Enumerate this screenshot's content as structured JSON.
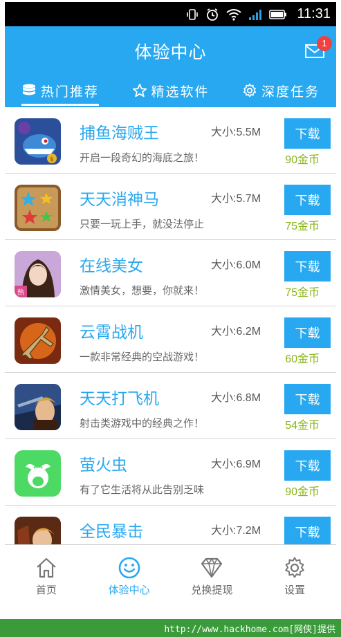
{
  "status_bar": {
    "time": "11:31"
  },
  "header": {
    "title": "体验中心",
    "badge_count": "1"
  },
  "tabs": [
    {
      "label": "热门推荐",
      "icon": "database-stack-icon",
      "active": true
    },
    {
      "label": "精选软件",
      "icon": "star-outline-icon",
      "active": false
    },
    {
      "label": "深度任务",
      "icon": "gear-icon",
      "active": false
    }
  ],
  "apps": [
    {
      "name": "捕鱼海贼王",
      "size": "大小:5.5M",
      "desc": "开启一段奇幻的海底之旅！",
      "button": "下载",
      "coins": "90金币",
      "icon": "shark-game-icon"
    },
    {
      "name": "天天消神马",
      "size": "大小:5.7M",
      "desc": "只要一玩上手，就没法停止",
      "button": "下载",
      "coins": "75金币",
      "icon": "star-match-game-icon"
    },
    {
      "name": "在线美女",
      "size": "大小:6.0M",
      "desc": "激情美女，想要，你就来！",
      "button": "下载",
      "coins": "75金币",
      "icon": "girl-portrait-icon"
    },
    {
      "name": "云霄战机",
      "size": "大小:6.2M",
      "desc": "一款非常经典的空战游戏！",
      "button": "下载",
      "coins": "60金币",
      "icon": "fighter-jet-icon"
    },
    {
      "name": "天天打飞机",
      "size": "大小:6.8M",
      "desc": "射击类游戏中的经典之作！",
      "button": "下载",
      "coins": "54金币",
      "icon": "warrior-game-icon"
    },
    {
      "name": "萤火虫",
      "size": "大小:6.9M",
      "desc": "有了它生活将从此告别乏味",
      "button": "下载",
      "coins": "90金币",
      "icon": "firefly-icon"
    },
    {
      "name": "全民暴击",
      "size": "大小:7.2M",
      "desc": "",
      "button": "下载",
      "coins": "",
      "icon": "fighter-character-icon"
    }
  ],
  "bottom_nav": [
    {
      "label": "首页",
      "icon": "home-icon",
      "active": false
    },
    {
      "label": "体验中心",
      "icon": "smiley-icon",
      "active": true
    },
    {
      "label": "兑换提现",
      "icon": "diamond-icon",
      "active": false
    },
    {
      "label": "设置",
      "icon": "settings-gear-icon",
      "active": false
    }
  ],
  "footer": {
    "text": "http://www.hackhome.com[网侠]提供"
  },
  "colors": {
    "accent": "#28a8f0",
    "coins": "#8ab51a",
    "badge": "#f04040",
    "footer": "#3b9b3b"
  }
}
